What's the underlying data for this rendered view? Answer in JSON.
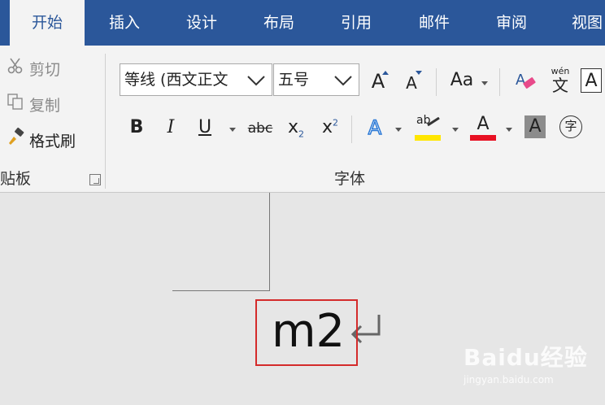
{
  "tabs": [
    {
      "label": "开始",
      "active": true
    },
    {
      "label": "插入",
      "active": false
    },
    {
      "label": "设计",
      "active": false
    },
    {
      "label": "布局",
      "active": false
    },
    {
      "label": "引用",
      "active": false
    },
    {
      "label": "邮件",
      "active": false
    },
    {
      "label": "审阅",
      "active": false
    },
    {
      "label": "视图",
      "active": false
    }
  ],
  "clipboard": {
    "cut_label": "剪切",
    "copy_label": "复制",
    "format_painter_label": "格式刷",
    "group_label": "贴板"
  },
  "font": {
    "font_name": "等线 (西文正文",
    "font_size": "五号",
    "grow_font": "A",
    "shrink_font": "A",
    "change_case": "Aa",
    "phonetic_top": "wén",
    "phonetic_bottom": "文",
    "char_border": "A",
    "bold": "B",
    "italic": "I",
    "underline": "U",
    "strikethrough": "abc",
    "subscript_base": "x",
    "subscript_mark": "2",
    "superscript_base": "x",
    "superscript_mark": "2",
    "text_effect": "A",
    "highlight_text": "ab",
    "font_color": "A",
    "char_shading": "A",
    "enclose_char": "字",
    "group_label": "字体"
  },
  "document": {
    "text": "m2"
  },
  "watermark": {
    "name": "Baidu经验",
    "url": "jingyan.baidu.com"
  },
  "colors": {
    "tab_bar": "#2b579a",
    "ribbon": "#f3f3f3",
    "highlight_yellow": "#ffe600",
    "font_red": "#e81123",
    "selection_red": "#d42b2b"
  }
}
